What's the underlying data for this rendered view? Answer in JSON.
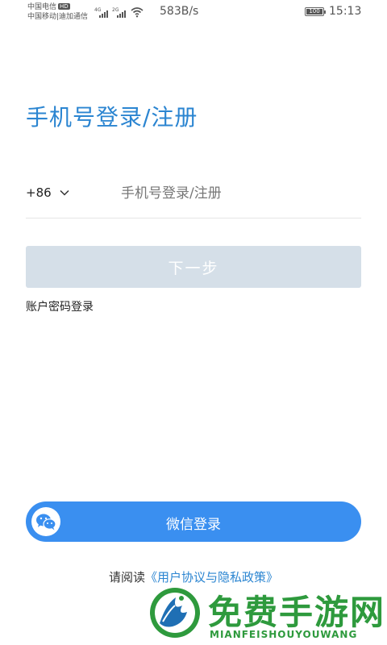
{
  "status_bar": {
    "carrier_line1": "中国电信",
    "carrier_badge": "HD",
    "carrier_line2": "中国移动|迪加通信",
    "signal1_gen": "4G",
    "signal2_gen": "2G",
    "net_speed": "583B/s",
    "battery_level": "100",
    "time": "15:13"
  },
  "title": "手机号登录/注册",
  "phone": {
    "country_code": "+86",
    "placeholder": "手机号登录/注册",
    "value": ""
  },
  "next_button": "下一步",
  "password_login": "账户密码登录",
  "wechat_login": "微信登录",
  "agreement": {
    "prefix": "请阅读",
    "link": "《用户协议与隐私政策》"
  },
  "watermark": {
    "title": "免费手游网",
    "subtitle": "MIANFEISHOUYOUWANG"
  },
  "colors": {
    "accent": "#2b85d1",
    "button_disabled": "#d5dfe8",
    "wechat_button": "#3a8ff0",
    "watermark_green": "#2e9a3d"
  }
}
